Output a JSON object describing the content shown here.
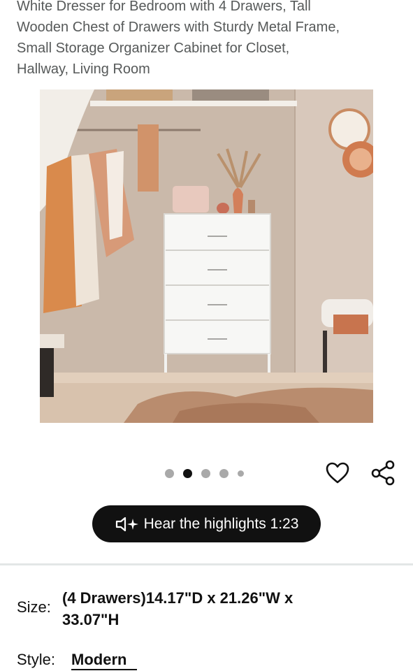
{
  "product": {
    "title_lines": [
      "White Dresser for Bedroom with 4 Drawers, Tall",
      "Wooden Chest of Drawers with Sturdy Metal Frame,",
      "Small Storage Organizer Cabinet for Closet,",
      "Hallway, Living Room"
    ]
  },
  "gallery": {
    "image_alt": "White 4-drawer dresser in a closet",
    "dot_count": 5,
    "active_index": 1
  },
  "actions": {
    "favorite_icon": "heart-icon",
    "share_icon": "share-icon"
  },
  "audio": {
    "label": "Hear the highlights 1:23",
    "icon": "speaker-sparkle-icon"
  },
  "variations": {
    "size_label": "Size:",
    "size_value_lines": [
      "(4 Drawers)14.17\"D x 21.26\"W x",
      "33.07\"H"
    ],
    "style_label": "Style:",
    "style_value": "Modern"
  }
}
